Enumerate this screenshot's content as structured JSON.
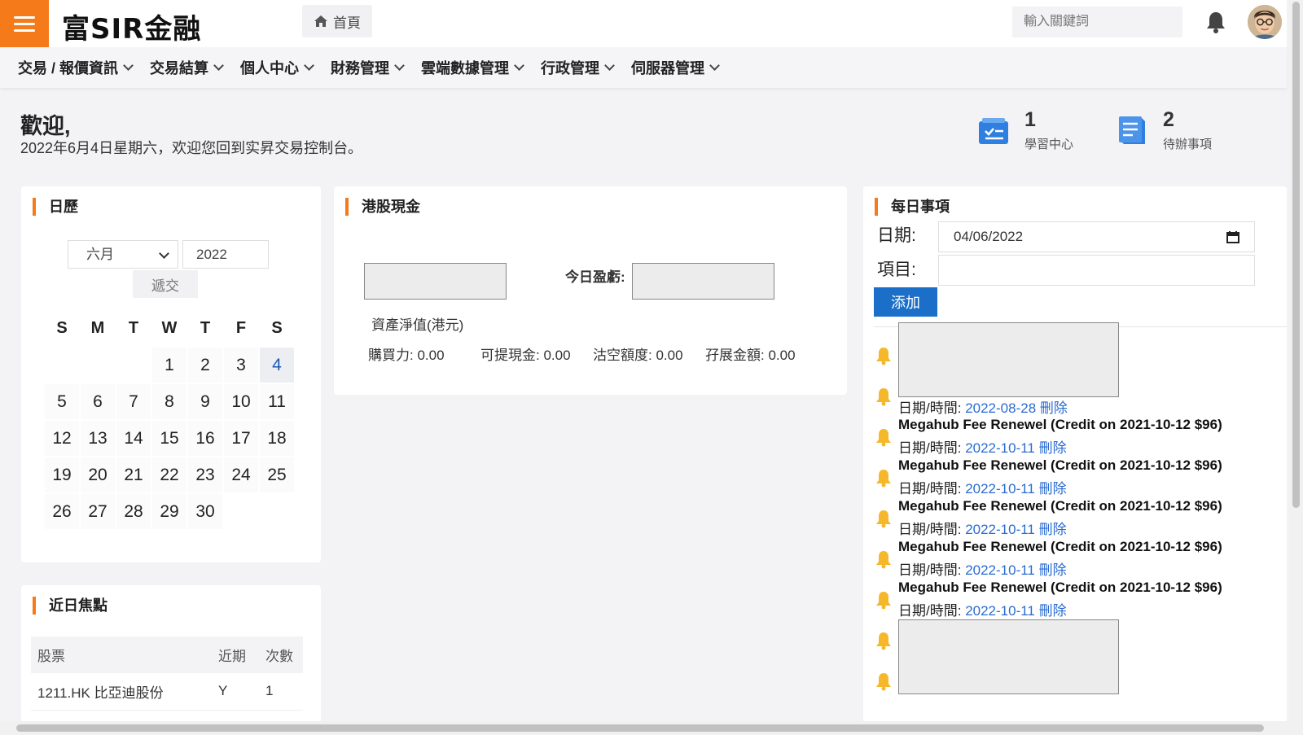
{
  "header": {
    "logo": "富SIR金融",
    "home_label": "首頁",
    "search_placeholder": "輸入關鍵詞"
  },
  "nav": [
    {
      "label": "交易 / 報價資訊"
    },
    {
      "label": "交易結算"
    },
    {
      "label": "個人中心"
    },
    {
      "label": "財務管理"
    },
    {
      "label": "雲端數據管理"
    },
    {
      "label": "行政管理"
    },
    {
      "label": "伺服器管理"
    }
  ],
  "welcome": {
    "title": "歡迎,",
    "subtitle": "2022年6月4日星期六，欢迎您回到实昇交易控制台。"
  },
  "stats": {
    "learning": {
      "count": "1",
      "label": "學習中心"
    },
    "todo": {
      "count": "2",
      "label": "待辦事項"
    }
  },
  "calendar": {
    "title": "日歷",
    "month": "六月",
    "year": "2022",
    "submit_label": "遞交",
    "weekdays": [
      "S",
      "M",
      "T",
      "W",
      "T",
      "F",
      "S"
    ],
    "leading_blanks": 3,
    "days": [
      "1",
      "2",
      "3",
      "4",
      "5",
      "6",
      "7",
      "8",
      "9",
      "10",
      "11",
      "12",
      "13",
      "14",
      "15",
      "16",
      "17",
      "18",
      "19",
      "20",
      "21",
      "22",
      "23",
      "24",
      "25",
      "26",
      "27",
      "28",
      "29",
      "30"
    ],
    "today": "4"
  },
  "focus": {
    "title": "近日焦點",
    "headers": {
      "stock": "股票",
      "recent": "近期",
      "count": "次數"
    },
    "rows": [
      {
        "stock": "1211.HK 比亞迪股份",
        "recent": "Y",
        "count": "1"
      }
    ]
  },
  "hk_cash": {
    "title": "港股現金",
    "today_pnl_label": "今日盈虧:",
    "net_asset_label": "資產淨值(港元)",
    "buying_power": "購買力: 0.00",
    "withdrawable": "可提現金: 0.00",
    "short_limit": "沽空額度: 0.00",
    "margin_amount": "孖展金額: 0.00"
  },
  "daily": {
    "title": "每日事項",
    "date_label": "日期:",
    "date_value": "04/06/2022",
    "item_label": "項目:",
    "add_label": "添加",
    "date_prefix": "日期/時間:",
    "delete_label": "刪除",
    "events": [
      {
        "title": "",
        "date": "2022-08-28"
      },
      {
        "title": "Megahub Fee Renewel (Credit on 2021-10-12 $96)",
        "date": "2022-10-11"
      },
      {
        "title": "Megahub Fee Renewel (Credit on 2021-10-12 $96)",
        "date": "2022-10-11"
      },
      {
        "title": "Megahub Fee Renewel (Credit on 2021-10-12 $96)",
        "date": "2022-10-11"
      },
      {
        "title": "Megahub Fee Renewel (Credit on 2021-10-12 $96)",
        "date": "2022-10-11"
      },
      {
        "title": "Megahub Fee Renewel (Credit on 2021-10-12 $96)",
        "date": "2022-10-11"
      }
    ]
  },
  "colors": {
    "accent": "#f57a1a",
    "primary": "#1b6fc9",
    "link": "#2a6bd0"
  }
}
